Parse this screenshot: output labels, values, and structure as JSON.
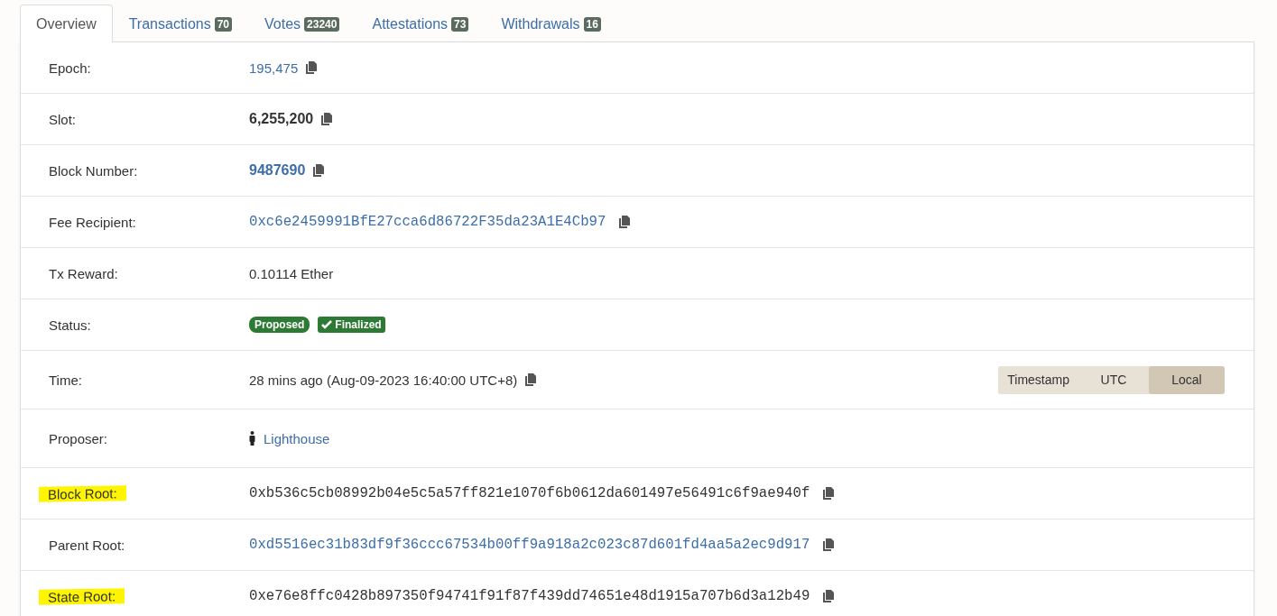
{
  "tabs": [
    {
      "label": "Overview",
      "selected": true
    },
    {
      "label": "Transactions",
      "count": "70",
      "selected": false
    },
    {
      "label": "Votes",
      "count": "23240",
      "selected": false
    },
    {
      "label": "Attestations",
      "count": "73",
      "selected": false
    },
    {
      "label": "Withdrawals",
      "count": "16",
      "selected": false
    }
  ],
  "rows": [
    {
      "label": "Epoch:",
      "kind": "link",
      "value": "195,475",
      "copy": true,
      "highlighted": false
    },
    {
      "label": "Slot:",
      "kind": "bold",
      "value": "6,255,200",
      "copy": true,
      "highlighted": false
    },
    {
      "label": "Block Number:",
      "kind": "bold_link",
      "value": "9487690",
      "copy": true,
      "highlighted": false
    },
    {
      "label": "Fee Recipient:",
      "kind": "hash_link",
      "value": "0xc6e2459991BfE27cca6d86722F35da23A1E4Cb97",
      "copy": true,
      "highlighted": false
    },
    {
      "label": "Tx Reward:",
      "kind": "text",
      "value": "0.10114 Ether",
      "copy": false,
      "highlighted": false
    },
    {
      "label": "Status:",
      "kind": "badges",
      "badges": [
        {
          "label": "Proposed",
          "check": false
        },
        {
          "label": "Finalized",
          "check": true
        }
      ],
      "copy": false,
      "highlighted": false
    },
    {
      "label": "Time:",
      "kind": "time",
      "value": "28 mins ago (Aug-09-2023 16:40:00 UTC+8)",
      "copy": true,
      "highlighted": false,
      "modes": [
        {
          "label": "Timestamp",
          "selected": false
        },
        {
          "label": "UTC",
          "selected": false
        },
        {
          "label": "Local",
          "selected": true
        }
      ]
    },
    {
      "label": "Proposer:",
      "kind": "proposer",
      "value": "Lighthouse",
      "copy": false,
      "highlighted": false
    },
    {
      "label": "Block Root:",
      "kind": "hash",
      "value": "0xb536c5cb08992b04e5c5a57ff821e1070f6b0612da601497e56491c6f9ae940f",
      "copy": true,
      "highlighted": true
    },
    {
      "label": "Parent Root:",
      "kind": "hash_link",
      "value": "0xd5516ec31b83df9f36ccc67534b00ff9a918a2c023c87d601fd4aa5a2ec9d917",
      "copy": true,
      "highlighted": false
    },
    {
      "label": "State Root:",
      "kind": "hash",
      "value": "0xe76e8ffc0428b897350f94741f91f87f439dd74651e48d1915a707b6d3a12b49",
      "copy": true,
      "highlighted": true
    }
  ]
}
